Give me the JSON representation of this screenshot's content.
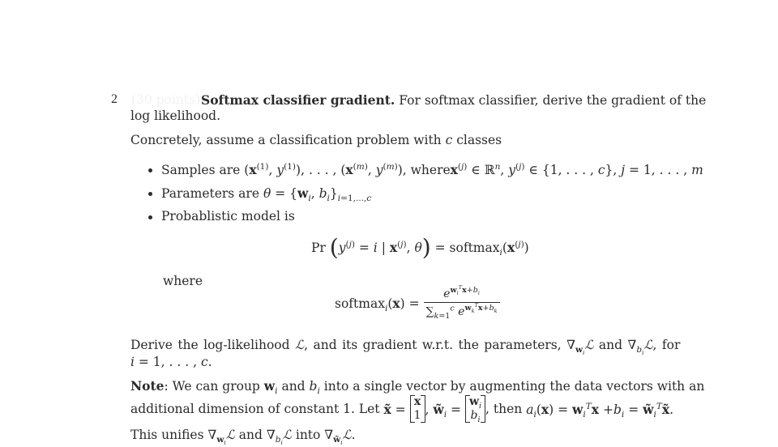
{
  "problem": {
    "number": "2",
    "points_label": "(30 points)",
    "title": "Softmax classifier gradient.",
    "intro_line1": "For softmax classifier, derive the gradient of the",
    "intro_line2": "log likelihood.",
    "concretely": "Concretely, assume a classification problem with",
    "concretely_var": "c",
    "concretely_tail": "classes"
  },
  "bullets": [
    {
      "label": "Samples are",
      "math_left": "(x(1), y(1)), . . . , (x(m), y(m)),",
      "where": "where",
      "math_right": "x(j) ∈ ℝn, y(j) ∈ {1, . . . , c}, j = 1, . . . , m"
    },
    {
      "label": "Parameters are",
      "math": "θ = {wi, bi}i=1,...,c"
    },
    {
      "label": "Probablistic model is"
    }
  ],
  "equations": {
    "model": "Pr( y(j) = i | x(j), θ ) = softmaxi(x(j))",
    "where_label": "where",
    "softmax_lhs": "softmaxi(x) =",
    "softmax_num": "e^(wiT x + bi)",
    "softmax_den": "Σk=1..c e^(wkT x + bk)"
  },
  "derive": {
    "line1_a": "Derive the log-likelihood",
    "line1_b": ", and its gradient w.r.t.  the parameters,",
    "line1_c": "and",
    "line1_d": ", for",
    "line2": "i = 1, . . . , c."
  },
  "note": {
    "label": "Note",
    "line1": ": We can group",
    "line1_b": "and",
    "line1_c": "into a single vector by augmenting the data vectors with an",
    "line2_a": "additional dimension of constant 1. Let",
    "line2_b": ", then",
    "line3_a": "This unifies",
    "line3_b": "and",
    "line3_c": "into"
  }
}
